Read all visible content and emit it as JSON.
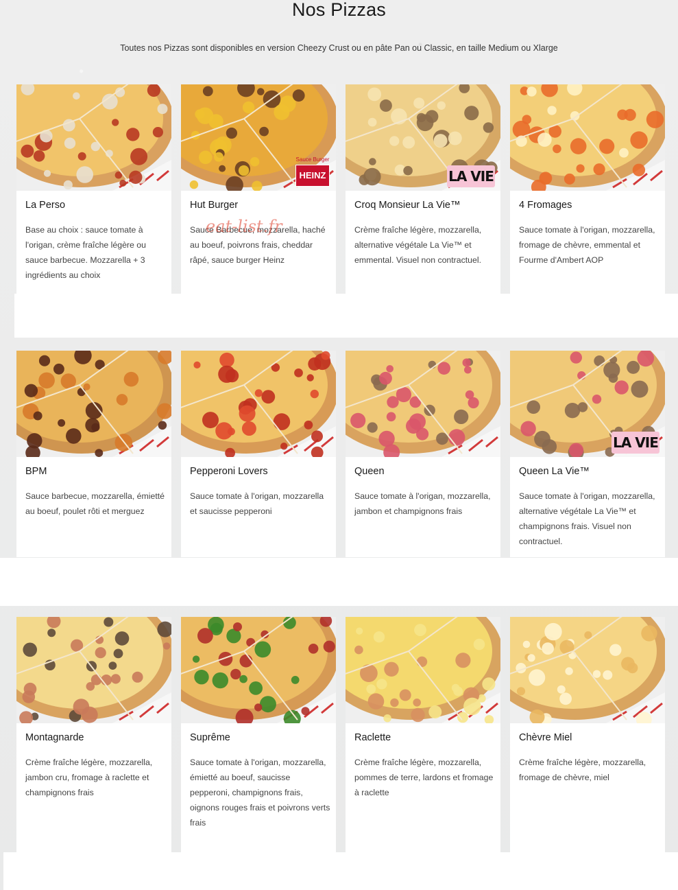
{
  "header": {
    "title": "Nos Pizzas",
    "subtitle": "Toutes nos Pizzas sont disponibles en version Cheezy Crust ou en pâte Pan ou Classic, en taille Medium ou Xlarge"
  },
  "watermark": "eat-list.fr",
  "badges": {
    "lavie": "LA VIE",
    "heinz_small": "Sauce Burger",
    "heinz_logo": "HEINZ"
  },
  "pizzas": [
    {
      "name": "La Perso",
      "desc": "Base au choix : sauce tomate à l'origan, crème fraîche légère ou sauce barbecue. Mozzarella + 3 ingrédients au choix"
    },
    {
      "name": "Hut Burger",
      "desc": "Sauce Barbecue, mozzarella, haché au boeuf, poivrons frais, cheddar râpé, sauce burger Heinz"
    },
    {
      "name": "Croq Monsieur La Vie™",
      "desc": "Crème fraîche légère, mozzarella, alternative végétale La Vie™ et emmental. Visuel non contractuel."
    },
    {
      "name": "4 Fromages",
      "desc": "Sauce tomate à l'origan, mozzarella, fromage de chèvre, emmental et Fourme d'Ambert AOP"
    },
    {
      "name": "BPM",
      "desc": "Sauce barbecue, mozzarella, émietté au boeuf, poulet rôti et merguez"
    },
    {
      "name": "Pepperoni Lovers",
      "desc": "Sauce tomate à l'origan, mozzarella et saucisse pepperoni"
    },
    {
      "name": "Queen",
      "desc": "Sauce tomate à l'origan, mozzarella, jambon et champignons frais"
    },
    {
      "name": "Queen La Vie™",
      "desc": "Sauce tomate à l'origan, mozzarella, alternative végétale La Vie™ et champignons frais. Visuel non contractuel."
    },
    {
      "name": "Montagnarde",
      "desc": "Crème fraîche légère, mozzarella, jambon cru, fromage à raclette et champignons frais"
    },
    {
      "name": "Suprême",
      "desc": "Sauce tomate à l'origan, mozzarella, émietté au boeuf, saucisse pepperoni, champignons frais, oignons rouges frais et poivrons verts frais"
    },
    {
      "name": "Raclette",
      "desc": "Crème fraîche légère, mozzarella, pommes de terre, lardons et fromage à raclette"
    },
    {
      "name": "Chèvre Miel",
      "desc": "Crème fraîche légère, mozzarella, fromage de chèvre, miel"
    }
  ]
}
